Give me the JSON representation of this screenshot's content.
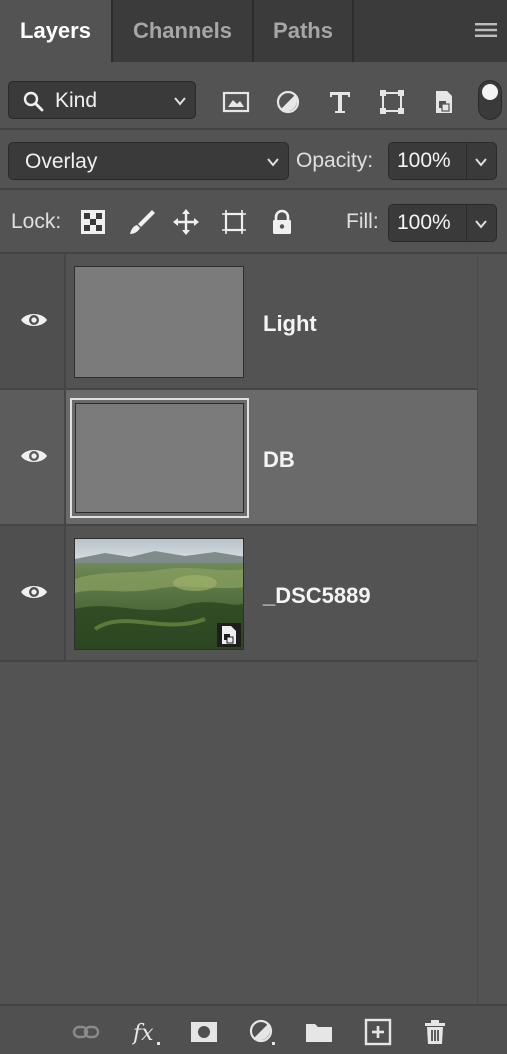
{
  "tabs": [
    {
      "label": "Layers",
      "active": true
    },
    {
      "label": "Channels",
      "active": false
    },
    {
      "label": "Paths",
      "active": false
    }
  ],
  "filter": {
    "kind_label": "Kind",
    "icons": [
      "pixel-layer-filter-icon",
      "adjustment-layer-filter-icon",
      "type-layer-filter-icon",
      "shape-layer-filter-icon",
      "smart-object-filter-icon"
    ]
  },
  "blend": {
    "mode": "Overlay",
    "opacity_label": "Opacity:",
    "opacity_value": "100%"
  },
  "lock": {
    "label": "Lock:",
    "icons": [
      "lock-transparent-pixels-icon",
      "lock-image-pixels-icon",
      "lock-position-icon",
      "lock-artboard-icon",
      "lock-all-icon"
    ],
    "fill_label": "Fill:",
    "fill_value": "100%"
  },
  "layers": [
    {
      "name": "Light",
      "visible": true,
      "selected": false,
      "thumbnail": "gray"
    },
    {
      "name": "DB",
      "visible": true,
      "selected": true,
      "thumbnail": "gray"
    },
    {
      "name": "_DSC5889",
      "visible": true,
      "selected": false,
      "thumbnail": "photo",
      "smart_object": true
    }
  ],
  "bottom_bar": [
    "link-layers-icon",
    "add-layer-style-icon",
    "add-mask-icon",
    "new-adjustment-layer-icon",
    "new-group-icon",
    "new-layer-icon",
    "delete-layer-icon"
  ],
  "colors": {
    "panel_bg": "#535353",
    "tab_bar_bg": "#3b3b3b",
    "selected_row": "#6a6a6a",
    "field_bg": "#3a3a3a"
  }
}
